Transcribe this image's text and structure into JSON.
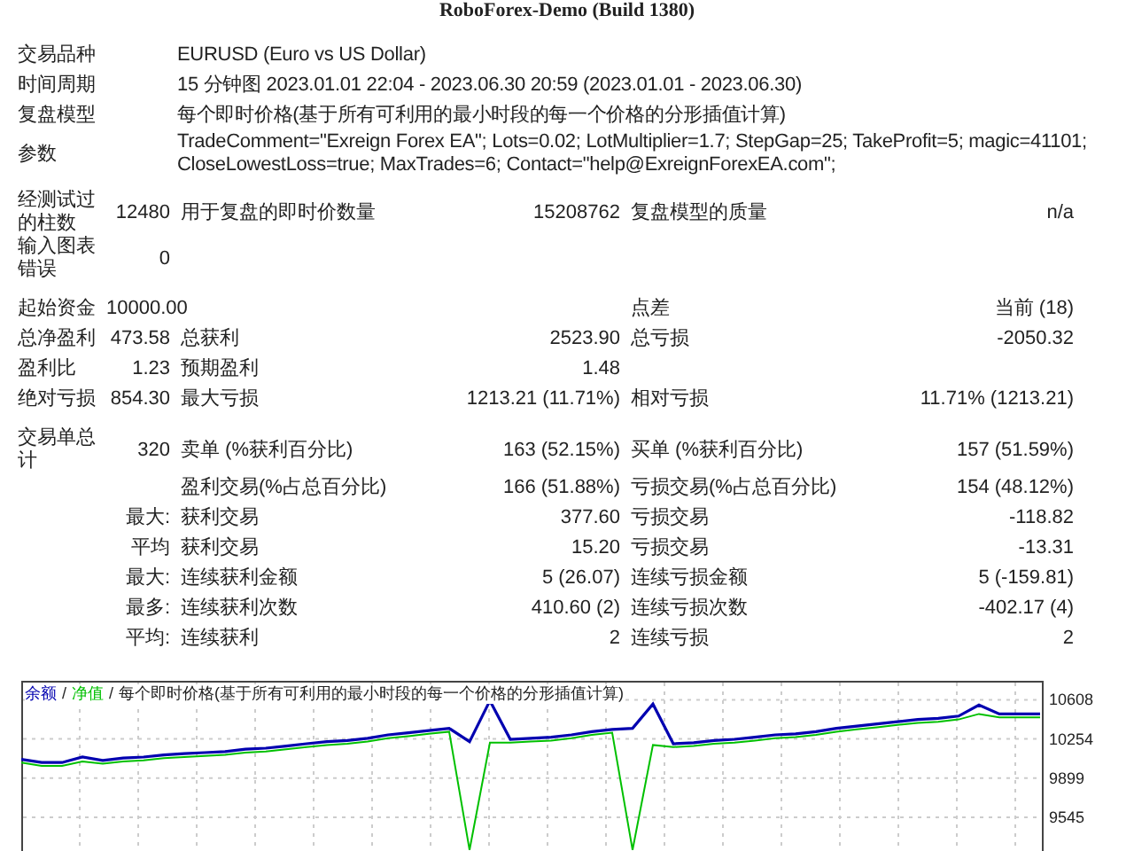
{
  "title": "RoboForex-Demo (Build 1380)",
  "info_rows": [
    {
      "label": "交易品种",
      "lines": [
        "EURUSD (Euro vs US Dollar)"
      ]
    },
    {
      "label": "时间周期",
      "lines": [
        "15 分钟图 2023.01.01 22:04 - 2023.06.30 20:59 (2023.01.01 - 2023.06.30)"
      ]
    },
    {
      "label": "复盘模型",
      "lines": [
        "每个即时价格(基于所有可利用的最小时段的每一个价格的分形插值计算)"
      ]
    },
    {
      "label": "参数",
      "lines": [
        "TradeComment=\"Exreign Forex EA\"; Lots=0.02; LotMultiplier=1.7; StepGap=25; TakeProfit=5; magic=41101;",
        "CloseLowestLoss=true; MaxTrades=6; Contact=\"help@ExreignForexEA.com\";"
      ]
    }
  ],
  "stats_groups": [
    [
      {
        "label": "经测试过的柱数",
        "value": "12480",
        "label_2": "用于复盘的即时价数量",
        "value_2": "15208762",
        "label_3": "复盘模型的质量",
        "value_3": "n/a"
      },
      {
        "label": "输入图表错误",
        "value": "0"
      }
    ],
    [
      {
        "label": "起始资金",
        "value": "10000.00",
        "label_3": "点差",
        "value_3": "当前 (18)"
      },
      {
        "label": "总净盈利",
        "value": "473.58",
        "label_2": "总获利",
        "value_2": "2523.90",
        "label_3": "总亏损",
        "value_3": "-2050.32"
      },
      {
        "label": "盈利比",
        "value": "1.23",
        "label_2": "预期盈利",
        "value_2": "1.48"
      },
      {
        "label": "绝对亏损",
        "value": "854.30",
        "label_2": "最大亏损",
        "value_2": "1213.21 (11.71%)",
        "label_3": "相对亏损",
        "value_3": "11.71% (1213.21)"
      }
    ],
    [
      {
        "label": "交易单总计",
        "value": "320",
        "label_2": "卖单 (%获利百分比)",
        "value_2": "163 (52.15%)",
        "label_3": "买单 (%获利百分比)",
        "value_3": "157 (51.59%)"
      },
      {
        "label_2": "盈利交易(%占总百分比)",
        "value_2": "166 (51.88%)",
        "label_3": "亏损交易(%占总百分比)",
        "value_3": "154 (48.12%)"
      },
      {
        "value": "最大:",
        "label_2": "获利交易",
        "value_2": "377.60",
        "label_3": "亏损交易",
        "value_3": "-118.82"
      },
      {
        "value": "平均",
        "label_2": "获利交易",
        "value_2": "15.20",
        "label_3": "亏损交易",
        "value_3": "-13.31"
      },
      {
        "value": "最大:",
        "label_2": "连续获利金额",
        "value_2": "5 (26.07)",
        "label_3": "连续亏损金额",
        "value_3": "5 (-159.81)"
      },
      {
        "value": "最多:",
        "label_2": "连续获利次数",
        "value_2": "410.60 (2)",
        "label_3": "连续亏损次数",
        "value_3": "-402.17 (4)"
      },
      {
        "value": "平均:",
        "label_2": "连续获利",
        "value_2": "2",
        "label_3": "连续亏损",
        "value_3": "2"
      }
    ]
  ],
  "chart": {
    "legend_separators": [
      "/",
      "/"
    ],
    "legend_note": "每个即时价格(基于所有可利用的最小时段的每一个价格的分形插值计算)",
    "chart_data": {
      "type": "line",
      "categories": [
        null,
        null,
        null,
        null,
        null,
        null,
        null,
        null,
        null,
        null,
        null,
        null,
        null,
        null,
        null,
        null,
        null,
        null,
        null,
        null,
        null,
        null,
        null,
        null,
        null,
        null,
        null,
        null,
        null,
        null,
        null,
        null,
        null,
        null,
        null,
        null,
        null,
        null,
        null,
        null,
        null,
        null,
        null,
        null,
        null,
        null,
        null,
        null,
        null,
        null,
        null
      ],
      "series": [
        {
          "name": "净值",
          "color": "#00c000",
          "values": [
            10040,
            10010,
            10010,
            10050,
            10030,
            10050,
            10060,
            10080,
            10090,
            10100,
            10110,
            10130,
            10140,
            10160,
            10180,
            10200,
            10210,
            10230,
            10260,
            10280,
            10300,
            10320,
            9250,
            10220,
            10220,
            10230,
            10240,
            10260,
            10290,
            10310,
            9250,
            10200,
            10180,
            10190,
            10210,
            10220,
            10240,
            10260,
            10270,
            10290,
            10320,
            10340,
            10360,
            10380,
            10400,
            10410,
            10430,
            10480,
            10450,
            10450,
            10450
          ]
        },
        {
          "name": "余额",
          "color": "#0000b0",
          "values": [
            10070,
            10040,
            10040,
            10090,
            10060,
            10080,
            10090,
            10110,
            10120,
            10130,
            10140,
            10160,
            10170,
            10190,
            10210,
            10230,
            10240,
            10260,
            10290,
            10310,
            10330,
            10350,
            10230,
            10600,
            10250,
            10260,
            10270,
            10290,
            10320,
            10340,
            10350,
            10570,
            10210,
            10220,
            10240,
            10250,
            10270,
            10290,
            10300,
            10320,
            10350,
            10370,
            10390,
            10410,
            10430,
            10440,
            10460,
            10560,
            10480,
            10480,
            10480
          ]
        }
      ],
      "ylim": [
        9240,
        10780
      ],
      "grid": true,
      "yticks": [
        10608,
        10254,
        9899,
        9545
      ]
    }
  }
}
